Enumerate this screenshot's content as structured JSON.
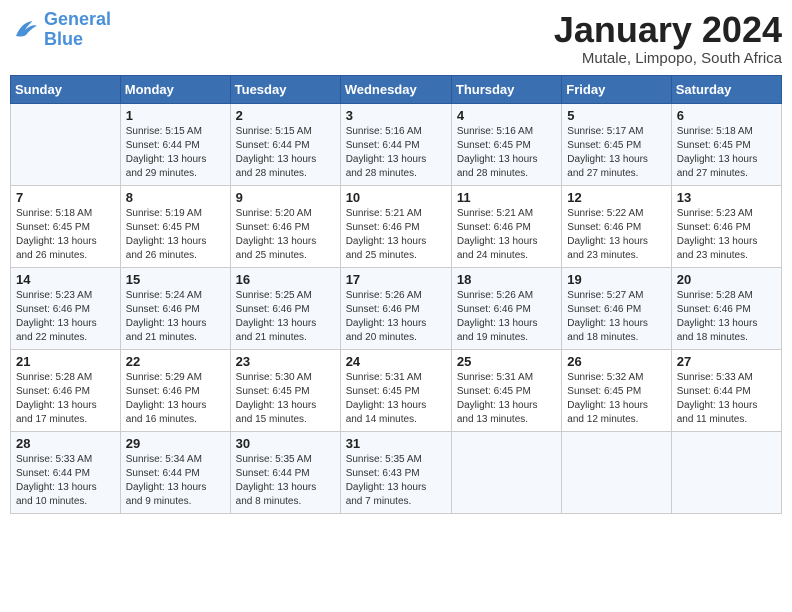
{
  "logo": {
    "line1": "General",
    "line2": "Blue"
  },
  "title": "January 2024",
  "location": "Mutale, Limpopo, South Africa",
  "weekdays": [
    "Sunday",
    "Monday",
    "Tuesday",
    "Wednesday",
    "Thursday",
    "Friday",
    "Saturday"
  ],
  "weeks": [
    [
      {
        "day": "",
        "info": ""
      },
      {
        "day": "1",
        "info": "Sunrise: 5:15 AM\nSunset: 6:44 PM\nDaylight: 13 hours\nand 29 minutes."
      },
      {
        "day": "2",
        "info": "Sunrise: 5:15 AM\nSunset: 6:44 PM\nDaylight: 13 hours\nand 28 minutes."
      },
      {
        "day": "3",
        "info": "Sunrise: 5:16 AM\nSunset: 6:44 PM\nDaylight: 13 hours\nand 28 minutes."
      },
      {
        "day": "4",
        "info": "Sunrise: 5:16 AM\nSunset: 6:45 PM\nDaylight: 13 hours\nand 28 minutes."
      },
      {
        "day": "5",
        "info": "Sunrise: 5:17 AM\nSunset: 6:45 PM\nDaylight: 13 hours\nand 27 minutes."
      },
      {
        "day": "6",
        "info": "Sunrise: 5:18 AM\nSunset: 6:45 PM\nDaylight: 13 hours\nand 27 minutes."
      }
    ],
    [
      {
        "day": "7",
        "info": "Sunrise: 5:18 AM\nSunset: 6:45 PM\nDaylight: 13 hours\nand 26 minutes."
      },
      {
        "day": "8",
        "info": "Sunrise: 5:19 AM\nSunset: 6:45 PM\nDaylight: 13 hours\nand 26 minutes."
      },
      {
        "day": "9",
        "info": "Sunrise: 5:20 AM\nSunset: 6:46 PM\nDaylight: 13 hours\nand 25 minutes."
      },
      {
        "day": "10",
        "info": "Sunrise: 5:21 AM\nSunset: 6:46 PM\nDaylight: 13 hours\nand 25 minutes."
      },
      {
        "day": "11",
        "info": "Sunrise: 5:21 AM\nSunset: 6:46 PM\nDaylight: 13 hours\nand 24 minutes."
      },
      {
        "day": "12",
        "info": "Sunrise: 5:22 AM\nSunset: 6:46 PM\nDaylight: 13 hours\nand 23 minutes."
      },
      {
        "day": "13",
        "info": "Sunrise: 5:23 AM\nSunset: 6:46 PM\nDaylight: 13 hours\nand 23 minutes."
      }
    ],
    [
      {
        "day": "14",
        "info": "Sunrise: 5:23 AM\nSunset: 6:46 PM\nDaylight: 13 hours\nand 22 minutes."
      },
      {
        "day": "15",
        "info": "Sunrise: 5:24 AM\nSunset: 6:46 PM\nDaylight: 13 hours\nand 21 minutes."
      },
      {
        "day": "16",
        "info": "Sunrise: 5:25 AM\nSunset: 6:46 PM\nDaylight: 13 hours\nand 21 minutes."
      },
      {
        "day": "17",
        "info": "Sunrise: 5:26 AM\nSunset: 6:46 PM\nDaylight: 13 hours\nand 20 minutes."
      },
      {
        "day": "18",
        "info": "Sunrise: 5:26 AM\nSunset: 6:46 PM\nDaylight: 13 hours\nand 19 minutes."
      },
      {
        "day": "19",
        "info": "Sunrise: 5:27 AM\nSunset: 6:46 PM\nDaylight: 13 hours\nand 18 minutes."
      },
      {
        "day": "20",
        "info": "Sunrise: 5:28 AM\nSunset: 6:46 PM\nDaylight: 13 hours\nand 18 minutes."
      }
    ],
    [
      {
        "day": "21",
        "info": "Sunrise: 5:28 AM\nSunset: 6:46 PM\nDaylight: 13 hours\nand 17 minutes."
      },
      {
        "day": "22",
        "info": "Sunrise: 5:29 AM\nSunset: 6:46 PM\nDaylight: 13 hours\nand 16 minutes."
      },
      {
        "day": "23",
        "info": "Sunrise: 5:30 AM\nSunset: 6:45 PM\nDaylight: 13 hours\nand 15 minutes."
      },
      {
        "day": "24",
        "info": "Sunrise: 5:31 AM\nSunset: 6:45 PM\nDaylight: 13 hours\nand 14 minutes."
      },
      {
        "day": "25",
        "info": "Sunrise: 5:31 AM\nSunset: 6:45 PM\nDaylight: 13 hours\nand 13 minutes."
      },
      {
        "day": "26",
        "info": "Sunrise: 5:32 AM\nSunset: 6:45 PM\nDaylight: 13 hours\nand 12 minutes."
      },
      {
        "day": "27",
        "info": "Sunrise: 5:33 AM\nSunset: 6:44 PM\nDaylight: 13 hours\nand 11 minutes."
      }
    ],
    [
      {
        "day": "28",
        "info": "Sunrise: 5:33 AM\nSunset: 6:44 PM\nDaylight: 13 hours\nand 10 minutes."
      },
      {
        "day": "29",
        "info": "Sunrise: 5:34 AM\nSunset: 6:44 PM\nDaylight: 13 hours\nand 9 minutes."
      },
      {
        "day": "30",
        "info": "Sunrise: 5:35 AM\nSunset: 6:44 PM\nDaylight: 13 hours\nand 8 minutes."
      },
      {
        "day": "31",
        "info": "Sunrise: 5:35 AM\nSunset: 6:43 PM\nDaylight: 13 hours\nand 7 minutes."
      },
      {
        "day": "",
        "info": ""
      },
      {
        "day": "",
        "info": ""
      },
      {
        "day": "",
        "info": ""
      }
    ]
  ]
}
